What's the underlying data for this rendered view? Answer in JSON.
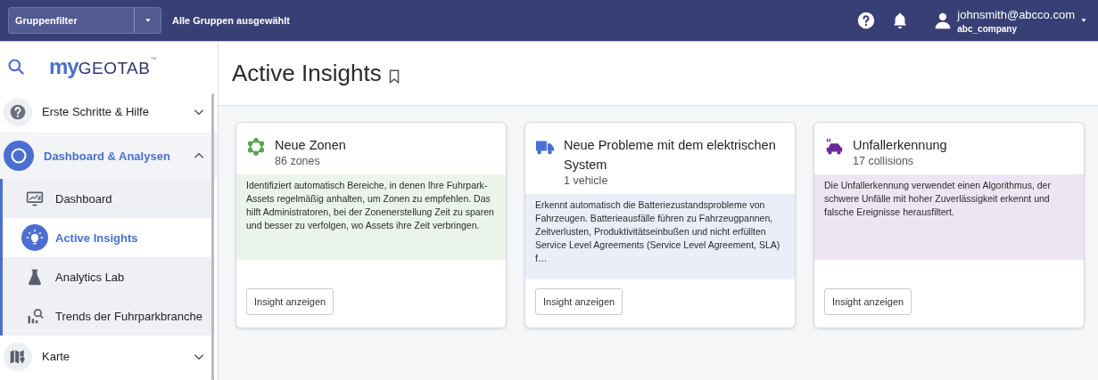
{
  "topbar": {
    "group_filter": {
      "label": "Gruppenfilter"
    },
    "group_status": "Alle Gruppen ausgewählt",
    "user": {
      "email": "johnsmith@abcco.com",
      "company": "abc_company"
    }
  },
  "logo": {
    "prefix": "my",
    "name": "GEOTAB",
    "mark": "™"
  },
  "sidebar": {
    "items": [
      {
        "kind": "help",
        "label": "Erste Schritte & Hilfe",
        "expanded": false,
        "selected": false
      },
      {
        "kind": "dashboard",
        "label": "Dashboard & Analysen",
        "expanded": true,
        "selected": true,
        "children": [
          {
            "kind": "monitor",
            "label": "Dashboard",
            "selected": false
          },
          {
            "kind": "bulb",
            "label": "Active Insights",
            "selected": true
          },
          {
            "kind": "flask",
            "label": "Analytics Lab",
            "selected": false
          },
          {
            "kind": "trends",
            "label": "Trends der Fuhrparkbranche",
            "selected": false
          }
        ]
      },
      {
        "kind": "map",
        "label": "Karte",
        "expanded": false,
        "selected": false
      }
    ]
  },
  "page": {
    "title": "Active Insights"
  },
  "cards": [
    {
      "kind": "zones",
      "color": "#5aa552",
      "title": "Neue Zonen",
      "count": "86 zones",
      "description": "Identifiziert automatisch Bereiche, in denen Ihre Fuhrpark-Assets regelmäßig anhalten, um Zonen zu empfehlen. Das hilft Administratoren, bei der Zonenerstellung Zeit zu sparen und besser zu verfolgen, wo Assets ihre Zeit verbringen.",
      "button": "Insight anzeigen"
    },
    {
      "kind": "truck",
      "color": "#4a6fd0",
      "title": "Neue Probleme mit dem elektrischen System",
      "count": "1 vehicle",
      "description": "Erkennt automatisch die Batteriezustandsprobleme von Fahrzeugen. Batterieausfälle führen zu Fahrzeugpannen, Zeitverlusten, Produktivitätseinbußen und nicht erfüllten Service Level Agreements (Service Level Agreement, SLA) f…",
      "button": "Insight anzeigen"
    },
    {
      "kind": "crash",
      "color": "#6b2a9a",
      "title": "Unfallerkennung",
      "count": "17 collisions",
      "description": "Die Unfallerkennung verwendet einen Algorithmus, der schwere Unfälle mit hoher Zuverlässigkeit erkennt und falsche Ereignisse herausfiltert.",
      "button": "Insight anzeigen"
    }
  ]
}
